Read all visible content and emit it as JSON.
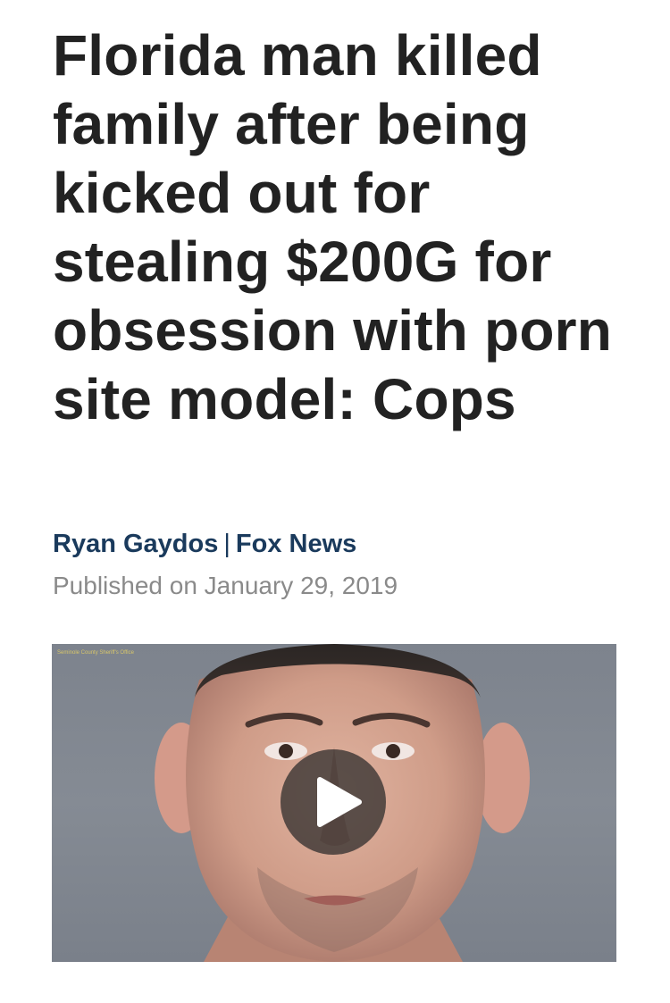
{
  "article": {
    "headline": "Florida man killed family after being kicked out for stealing $200G for obsession with porn site model: Cops",
    "author": "Ryan Gaydos",
    "separator": "|",
    "outlet": "Fox News",
    "published": "Published on January 29, 2019"
  },
  "video": {
    "credit": "Seminole County Sheriff's Office",
    "play_icon": "play-icon",
    "thumbnail": "mugshot-photo"
  },
  "colors": {
    "headline": "#222222",
    "byline": "#1a3a5c",
    "published": "#8a8a8a"
  }
}
